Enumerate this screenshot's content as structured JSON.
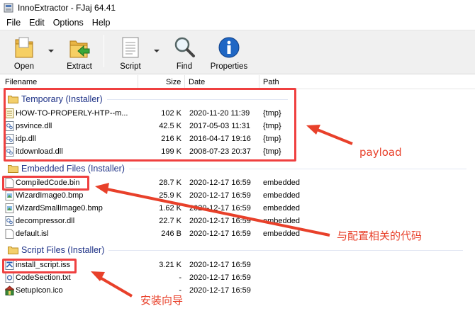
{
  "window": {
    "title": "InnoExtractor - FJaj 64.41"
  },
  "menu": [
    "File",
    "Edit",
    "Options",
    "Help"
  ],
  "toolbar": {
    "open": "Open",
    "extract": "Extract",
    "script": "Script",
    "find": "Find",
    "properties": "Properties"
  },
  "columns": {
    "filename": "Filename",
    "size": "Size",
    "date": "Date",
    "path": "Path"
  },
  "groups": [
    {
      "title": "Temporary (Installer)",
      "files": [
        {
          "name": "HOW-TO-PROPERLY-HTP--m...",
          "size": "102 K",
          "date": "2020-11-20 11:39",
          "path": "{tmp}",
          "icon": "text-file-icon"
        },
        {
          "name": "psvince.dll",
          "size": "42.5 K",
          "date": "2017-05-03 11:31",
          "path": "{tmp}",
          "icon": "dll-icon"
        },
        {
          "name": "idp.dll",
          "size": "216 K",
          "date": "2016-04-17 19:16",
          "path": "{tmp}",
          "icon": "dll-icon"
        },
        {
          "name": "itdownload.dll",
          "size": "199 K",
          "date": "2008-07-23 20:37",
          "path": "{tmp}",
          "icon": "dll-icon"
        }
      ]
    },
    {
      "title": "Embedded Files (Installer)",
      "files": [
        {
          "name": "CompiledCode.bin",
          "size": "28.7 K",
          "date": "2020-12-17 16:59",
          "path": "embedded",
          "icon": "blank-file-icon"
        },
        {
          "name": "WizardImage0.bmp",
          "size": "25.9 K",
          "date": "2020-12-17 16:59",
          "path": "embedded",
          "icon": "bitmap-icon"
        },
        {
          "name": "WizardSmallImage0.bmp",
          "size": "1.62 K",
          "date": "2020-12-17 16:59",
          "path": "embedded",
          "icon": "bitmap-icon"
        },
        {
          "name": "decompressor.dll",
          "size": "22.7 K",
          "date": "2020-12-17 16:59",
          "path": "embedded",
          "icon": "dll-icon"
        },
        {
          "name": "default.isl",
          "size": "246 B",
          "date": "2020-12-17 16:59",
          "path": "embedded",
          "icon": "blank-file-icon"
        }
      ]
    },
    {
      "title": "Script Files (Installer)",
      "files": [
        {
          "name": "install_script.iss",
          "size": "3.21 K",
          "date": "2020-12-17 16:59",
          "path": "",
          "icon": "script-file-icon"
        },
        {
          "name": "CodeSection.txt",
          "size": "-",
          "date": "2020-12-17 16:59",
          "path": "",
          "icon": "text-doc-icon"
        },
        {
          "name": "SetupIcon.ico",
          "size": "-",
          "date": "2020-12-17 16:59",
          "path": "",
          "icon": "setup-icon"
        }
      ]
    }
  ],
  "annotations": {
    "payload": "payload",
    "config_code": "与配置相关的代码",
    "install_wizard": "安装向导",
    "color": "#e8402a"
  }
}
